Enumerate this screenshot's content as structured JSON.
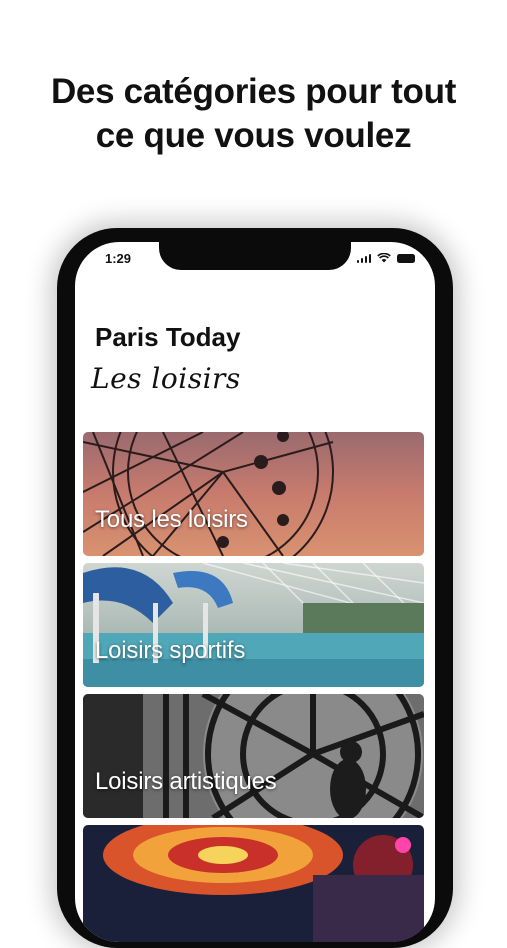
{
  "headline": {
    "line1": "Des catégories pour tout",
    "line2": "ce que vous voulez"
  },
  "status_bar": {
    "time": "1:29",
    "icons": [
      "signal-icon",
      "wifi-icon",
      "battery-icon"
    ]
  },
  "app": {
    "title": "Paris Today",
    "section": "Les loisirs"
  },
  "categories": [
    {
      "label": "Tous les loisirs",
      "image": "ferris-wheel-sunset"
    },
    {
      "label": "Loisirs sportifs",
      "image": "indoor-waterpark"
    },
    {
      "label": "Loisirs artistiques",
      "image": "museum-clock"
    },
    {
      "label": "",
      "image": "fairground-ride"
    }
  ],
  "colors": {
    "phone_frame": "#0b0b0b",
    "sunset": "#c9796a",
    "pool": "#4fa7b8"
  }
}
